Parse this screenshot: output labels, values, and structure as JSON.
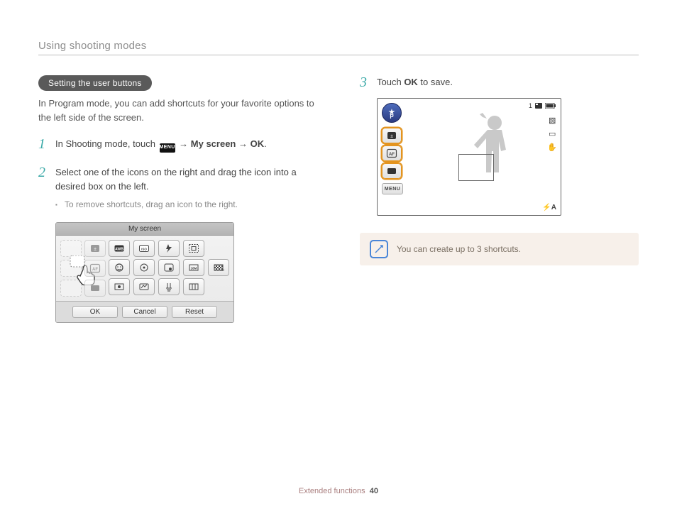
{
  "header": {
    "title": "Using shooting modes"
  },
  "pill": {
    "label": "Setting the user buttons"
  },
  "intro": "In Program mode, you can add shortcuts for your favorite options to the left side of the screen.",
  "steps": {
    "s1": {
      "num": "1",
      "pre": "In Shooting mode, touch ",
      "menu": "MENU",
      "arrow1": " → ",
      "b1": "My screen",
      "arrow2": " → ",
      "b2": "OK",
      "post": "."
    },
    "s2": {
      "num": "2",
      "text": "Select one of the icons on the right and drag the icon into a desired box on the left."
    },
    "bullet": "To remove shortcuts, drag an icon to the right.",
    "s3": {
      "num": "3",
      "pre": "Touch ",
      "b1": "OK",
      "post": " to save."
    }
  },
  "panel": {
    "title": "My screen",
    "buttons": {
      "ok": "OK",
      "cancel": "Cancel",
      "reset": "Reset"
    }
  },
  "camera": {
    "mode": "P",
    "menu": "MENU",
    "counter": "1",
    "flash": "A"
  },
  "note": {
    "text": "You can create up to 3 shortcuts."
  },
  "footer": {
    "section": "Extended functions",
    "page": "40"
  }
}
